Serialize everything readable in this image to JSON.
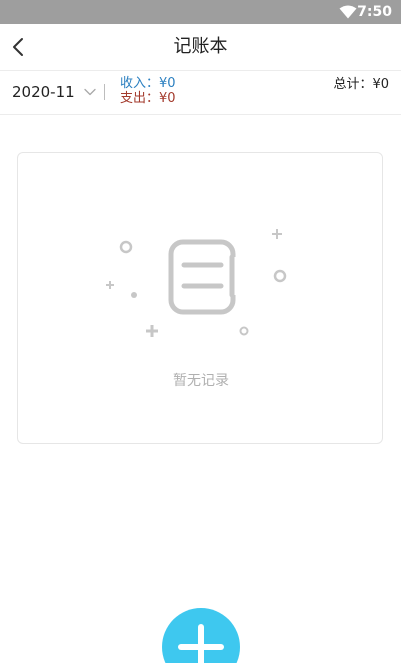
{
  "status_bar": {
    "time": "7:50",
    "icons": [
      "wifi-icon"
    ]
  },
  "header": {
    "title": "记账本",
    "back_icon": "back-icon"
  },
  "summary": {
    "month": "2020-11",
    "income": "收入：¥0",
    "expense": "支出：¥0",
    "total": "总计：¥0"
  },
  "empty_state": {
    "message": "暂无记录",
    "icon": "empty-records-icon"
  },
  "fab": {
    "icon": "plus-icon"
  },
  "colors": {
    "status_bar_bg": "#9e9e9e",
    "income": "#2a7fc0",
    "expense": "#a33a2c",
    "fab": "#3ec8ef",
    "empty_text": "#b0b0b0"
  }
}
